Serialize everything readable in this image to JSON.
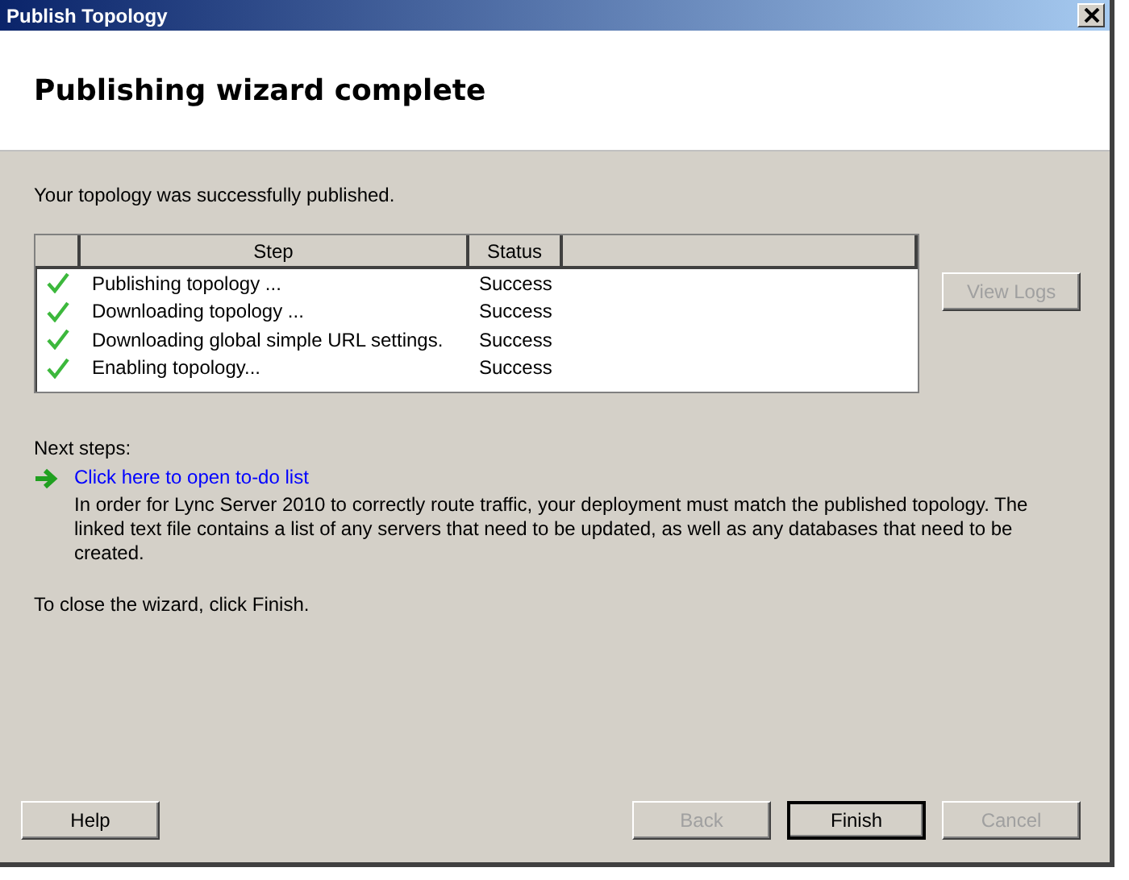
{
  "window": {
    "title": "Publish Topology"
  },
  "header": {
    "title": "Publishing wizard complete"
  },
  "intro": "Your topology was successfully published.",
  "table": {
    "columns": [
      "Step",
      "Status"
    ],
    "rows": [
      {
        "step": "Publishing topology ...",
        "status": "Success",
        "done": true
      },
      {
        "step": "Downloading topology ...",
        "status": "Success",
        "done": true
      },
      {
        "step": "Downloading global simple URL settings.",
        "status": "Success",
        "done": true
      },
      {
        "step": "Enabling topology...",
        "status": "Success",
        "done": true
      }
    ]
  },
  "view_logs": {
    "label": "View Logs",
    "disabled": true
  },
  "next_steps": {
    "label": "Next steps:",
    "link": "Click here to open to-do list",
    "description": "In order for Lync Server 2010 to correctly route traffic, your deployment must match the published topology. The linked text file contains a list of any servers that need to be updated, as well as any databases that need to be created."
  },
  "closing": "To close the wizard, click Finish.",
  "buttons": [
    {
      "label": "Help",
      "disabled": false,
      "default": false
    },
    {
      "label": "Back",
      "disabled": true,
      "default": false
    },
    {
      "label": "Finish",
      "disabled": false,
      "default": true
    },
    {
      "label": "Cancel",
      "disabled": true,
      "default": false
    }
  ]
}
